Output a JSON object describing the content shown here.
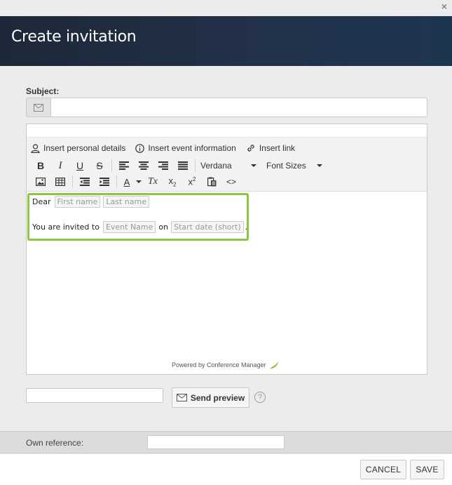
{
  "window": {
    "close_glyph": "×",
    "title": "Create invitation"
  },
  "subject": {
    "label": "Subject:",
    "value": "",
    "icon": "envelope-icon"
  },
  "toolbar": {
    "insert_personal": "Insert personal details",
    "insert_event": "Insert event information",
    "insert_link": "Insert link",
    "bold": "B",
    "italic": "I",
    "underline": "U",
    "strike": "S",
    "font_family": "Verdana",
    "font_sizes": "Font Sizes",
    "text_color": "A",
    "clear_format": "Tx",
    "code": "<>"
  },
  "body": {
    "line1_prefix": "Dear",
    "first_name_tag": "First name",
    "last_name_tag": "Last name",
    "line2_prefix": "You are invited to",
    "event_name_tag": "Event Name",
    "on_word": "on",
    "start_date_tag": "Start date (short)",
    "line2_suffix": "."
  },
  "powered_by": "Powered by Conference Manager",
  "preview": {
    "email_value": "",
    "send_label": "Send preview",
    "help_glyph": "?"
  },
  "own_reference": {
    "label": "Own reference:",
    "value": ""
  },
  "footer": {
    "cancel_label": "CANCEL",
    "save_label": "SAVE"
  },
  "colors": {
    "header_bg": "#1d2838",
    "highlight_border": "#8dc63f"
  }
}
